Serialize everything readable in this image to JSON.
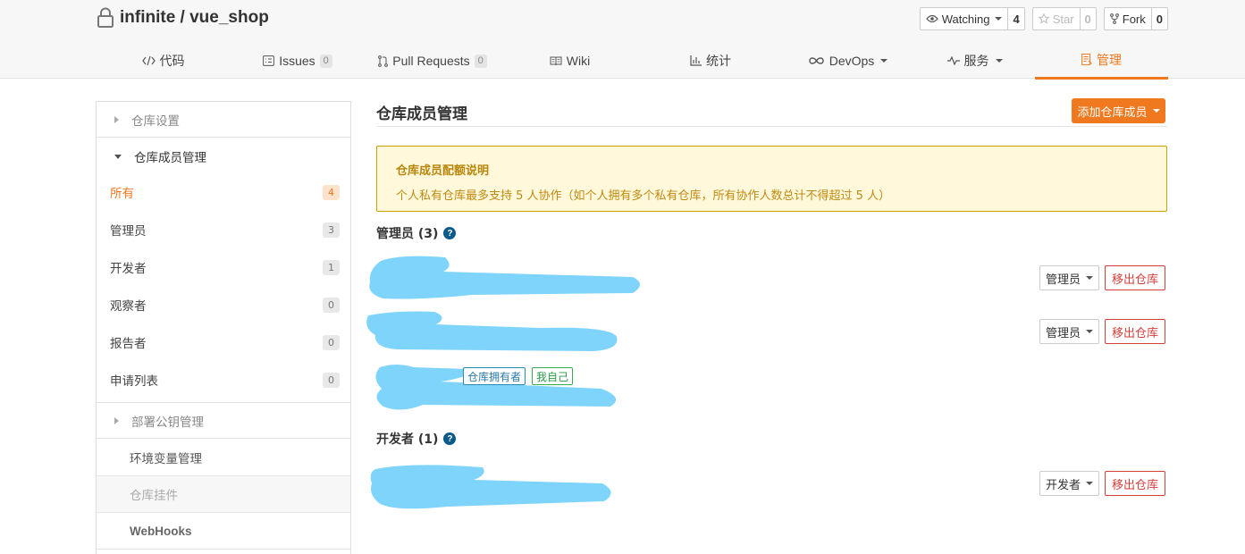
{
  "repo": {
    "title": "infinite / vue_shop"
  },
  "actions": {
    "watch": {
      "label": "Watching",
      "count": "4"
    },
    "star": {
      "label": "Star",
      "count": "0"
    },
    "fork": {
      "label": "Fork",
      "count": "0"
    }
  },
  "tabs": [
    {
      "label": "代码",
      "icon": "code-icon"
    },
    {
      "label": "Issues",
      "badge": "0",
      "icon": "issues-icon"
    },
    {
      "label": "Pull Requests",
      "badge": "0",
      "icon": "pull-request-icon"
    },
    {
      "label": "Wiki",
      "icon": "book-icon"
    },
    {
      "label": "统计",
      "icon": "bar-chart-icon"
    },
    {
      "label": "DevOps",
      "icon": "infinity-icon"
    },
    {
      "label": "服务",
      "icon": "pulse-icon"
    },
    {
      "label": "管理",
      "icon": "document-icon"
    }
  ],
  "sidebar": {
    "repo_settings": "仓库设置",
    "member_mgmt": "仓库成员管理",
    "items": [
      {
        "label": "所有",
        "count": "4"
      },
      {
        "label": "管理员",
        "count": "3"
      },
      {
        "label": "开发者",
        "count": "1"
      },
      {
        "label": "观察者",
        "count": "0"
      },
      {
        "label": "报告者",
        "count": "0"
      },
      {
        "label": "申请列表",
        "count": "0"
      }
    ],
    "deploy_keys": "部署公钥管理",
    "env_vars": "环境变量管理",
    "plugins": "仓库挂件",
    "webhooks": "WebHooks"
  },
  "main": {
    "title": "仓库成员管理",
    "add_button": "添加仓库成员",
    "notice": {
      "title": "仓库成员配额说明",
      "body": "个人私有仓库最多支持 5 人协作（如个人拥有多个私有仓库，所有协作人数总计不得超过 5 人）"
    },
    "admins_title": "管理员 (3)",
    "devs_title": "开发者 (1)",
    "help": "?",
    "tags": {
      "owner": "仓库拥有者",
      "self": "我自己"
    },
    "roles": {
      "admin": "管理员",
      "dev": "开发者"
    },
    "remove": "移出仓库"
  },
  "colors": {
    "accent": "#f0781e",
    "danger": "#d43f3a",
    "redaction": "#7fd4fb"
  }
}
